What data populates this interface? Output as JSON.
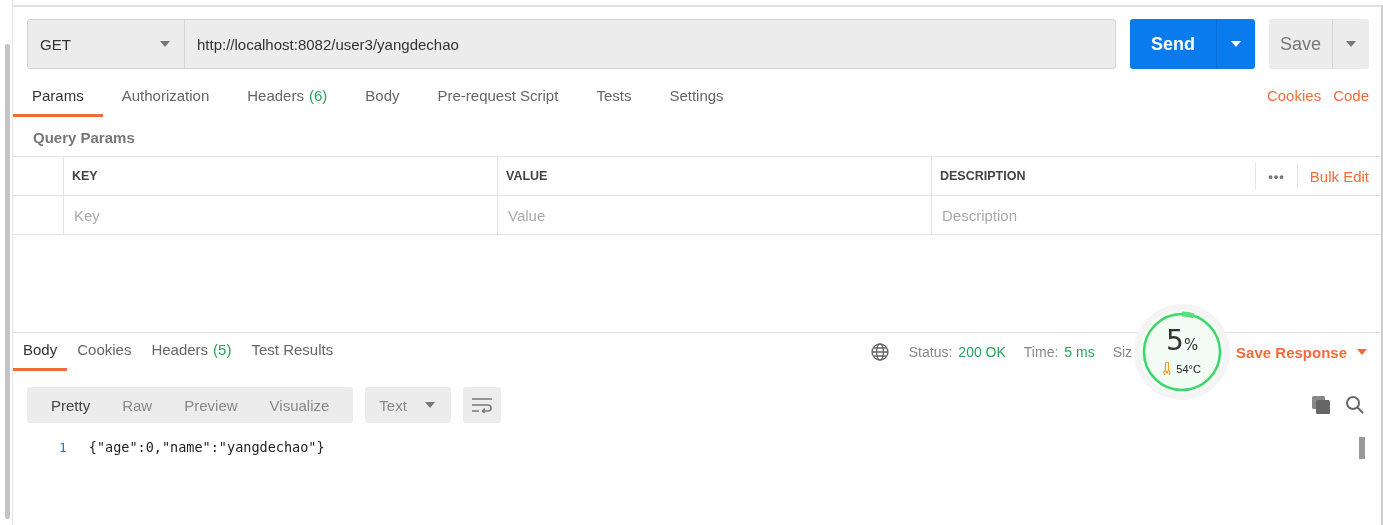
{
  "request": {
    "method": "GET",
    "url": "http://localhost:8082/user3/yangdechao",
    "send_label": "Send",
    "save_label": "Save"
  },
  "request_tabs": [
    {
      "label": "Params",
      "selected": true
    },
    {
      "label": "Authorization",
      "selected": false
    },
    {
      "label": "Headers",
      "count": "(6)",
      "selected": false
    },
    {
      "label": "Body",
      "selected": false
    },
    {
      "label": "Pre-request Script",
      "selected": false
    },
    {
      "label": "Tests",
      "selected": false
    },
    {
      "label": "Settings",
      "selected": false
    }
  ],
  "request_links": [
    "Cookies",
    "Code"
  ],
  "query_params": {
    "title": "Query Params",
    "columns": [
      "KEY",
      "VALUE",
      "DESCRIPTION"
    ],
    "more": "•••",
    "bulk_edit": "Bulk Edit",
    "placeholders": [
      "Key",
      "Value",
      "Description"
    ]
  },
  "response_tabs": [
    {
      "label": "Body",
      "selected": true
    },
    {
      "label": "Cookies",
      "selected": false
    },
    {
      "label": "Headers",
      "count": "(5)",
      "selected": false
    },
    {
      "label": "Test Results",
      "selected": false
    }
  ],
  "response_meta": [
    {
      "label": "Status:",
      "value": "200 OK"
    },
    {
      "label": "Time:",
      "value": "5 ms"
    },
    {
      "label": "Siz"
    }
  ],
  "save_response": "Save Response",
  "view_modes": [
    {
      "label": "Pretty",
      "selected": true
    },
    {
      "label": "Raw",
      "selected": false
    },
    {
      "label": "Preview",
      "selected": false
    },
    {
      "label": "Visualize",
      "selected": false
    }
  ],
  "format": "Text",
  "code_lines": [
    {
      "number": "1",
      "text": "{\"age\":0,\"name\":\"yangdechao\"}"
    }
  ],
  "monitor_widget": {
    "percent": "5",
    "unit": "%",
    "temperature": "54°C",
    "level": 0.05
  }
}
